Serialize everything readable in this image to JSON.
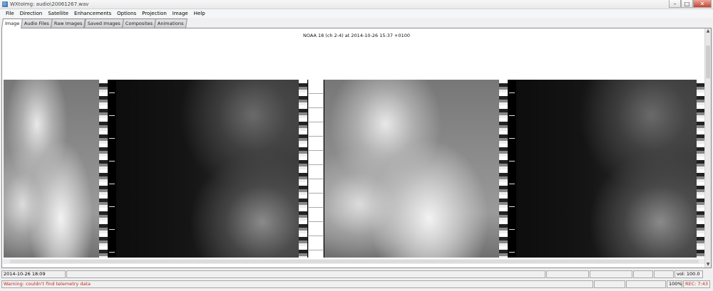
{
  "window": {
    "title": "WXtoImg: audio\\20061267.wav"
  },
  "menu": [
    "File",
    "Direction",
    "Satellite",
    "Enhancements",
    "Options",
    "Projection",
    "Image",
    "Help"
  ],
  "tabs": [
    "Image",
    "Audio Files",
    "Raw Images",
    "Saved Images",
    "Composites",
    "Animations"
  ],
  "image": {
    "caption": "NOAA 18 (ch 2-4) at 2014-10-26  15:37 +0100"
  },
  "status": {
    "datetime": "2014-10-26  18:09",
    "volume": "vol: 100.0",
    "warning": "Warning: couldn't find telemetry data",
    "zoom": "100%",
    "rec": "REC: 7:43"
  },
  "colors": {
    "warning_text": "#c0281e"
  }
}
